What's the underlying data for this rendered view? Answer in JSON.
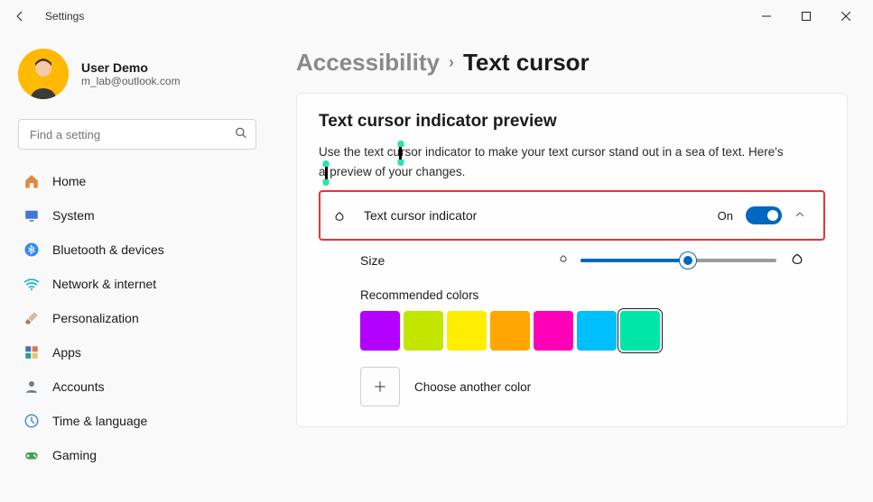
{
  "window": {
    "title": "Settings"
  },
  "profile": {
    "name": "User Demo",
    "email": "m_lab@outlook.com"
  },
  "search": {
    "placeholder": "Find a setting"
  },
  "nav": {
    "items": [
      {
        "label": "Home",
        "icon": "home-icon",
        "color": "#e0893e"
      },
      {
        "label": "System",
        "icon": "system-icon",
        "color": "#3b78d8"
      },
      {
        "label": "Bluetooth & devices",
        "icon": "bluetooth-icon",
        "color": "#2f88ff"
      },
      {
        "label": "Network & internet",
        "icon": "wifi-icon",
        "color": "#1fb5d0"
      },
      {
        "label": "Personalization",
        "icon": "paintbrush-icon",
        "color": "#a67c52"
      },
      {
        "label": "Apps",
        "icon": "apps-icon",
        "color": "#4a6fb0"
      },
      {
        "label": "Accounts",
        "icon": "accounts-icon",
        "color": "#6b7c8a"
      },
      {
        "label": "Time & language",
        "icon": "clock-icon",
        "color": "#4a8ad8"
      },
      {
        "label": "Gaming",
        "icon": "gaming-icon",
        "color": "#3fa34d"
      }
    ]
  },
  "breadcrumb": {
    "parent": "Accessibility",
    "current": "Text cursor"
  },
  "preview": {
    "title": "Text cursor indicator preview",
    "desc_pre": "Use the text cu",
    "desc_mid": "rsor indicator to make your text cursor stand out in a sea of text. Here's a",
    "desc_post": " preview of your changes."
  },
  "indicator": {
    "label": "Text cursor indicator",
    "state": "On",
    "on": true
  },
  "size": {
    "label": "Size",
    "value": 55
  },
  "colors": {
    "label": "Recommended colors",
    "swatches": [
      "#b400ff",
      "#c2e600",
      "#ffee00",
      "#ffa600",
      "#ff00b8",
      "#00bfff",
      "#00e6a8"
    ],
    "selected_index": 6,
    "another_label": "Choose another color"
  }
}
